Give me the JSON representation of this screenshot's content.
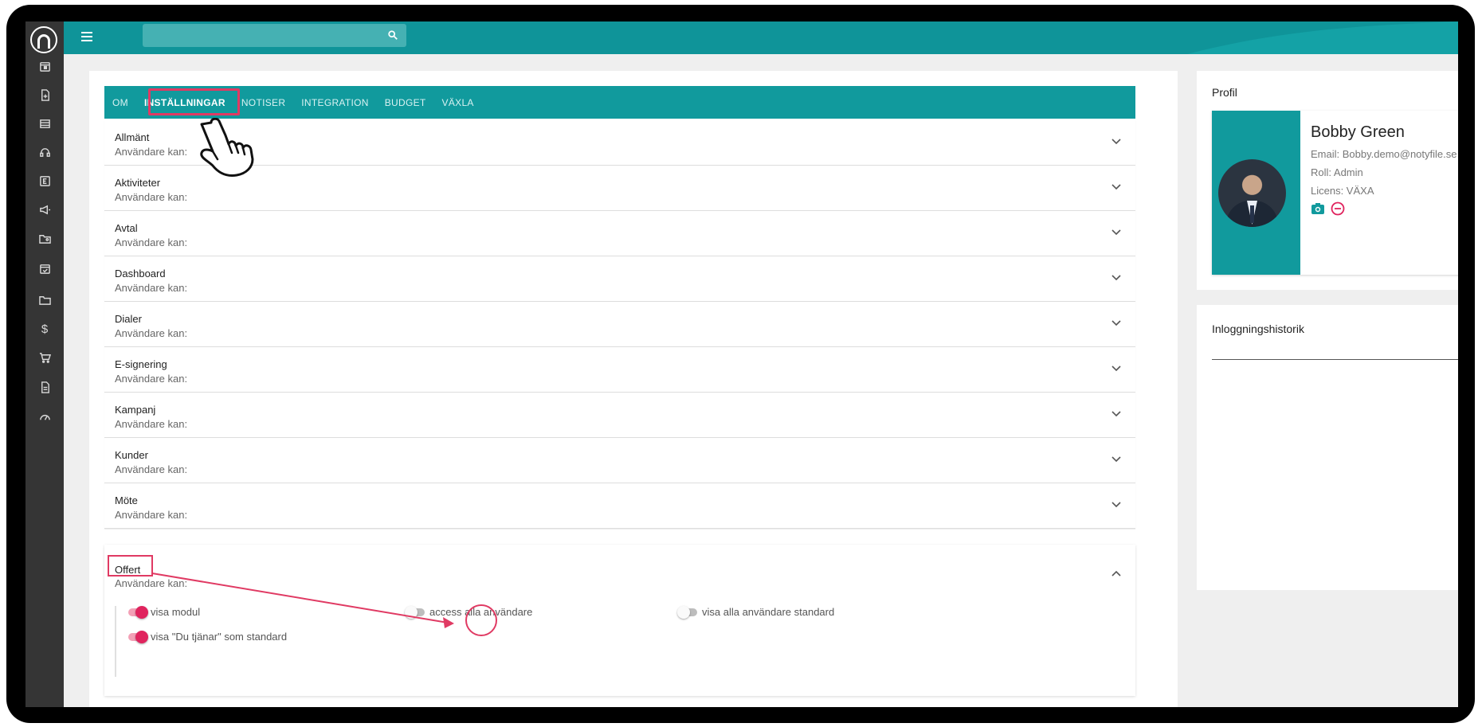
{
  "search": {
    "placeholder": ""
  },
  "tabs": [
    "OM",
    "INSTÄLLNINGAR",
    "NOTISER",
    "INTEGRATION",
    "BUDGET",
    "VÄXLA"
  ],
  "active_tab": "INSTÄLLNINGAR",
  "sections": [
    {
      "title": "Allmänt",
      "subtitle": "Användare kan:"
    },
    {
      "title": "Aktiviteter",
      "subtitle": "Användare kan:"
    },
    {
      "title": "Avtal",
      "subtitle": "Användare kan:"
    },
    {
      "title": "Dashboard",
      "subtitle": "Användare kan:"
    },
    {
      "title": "Dialer",
      "subtitle": "Användare kan:"
    },
    {
      "title": "E-signering",
      "subtitle": "Användare kan:"
    },
    {
      "title": "Kampanj",
      "subtitle": "Användare kan:"
    },
    {
      "title": "Kunder",
      "subtitle": "Användare kan:"
    },
    {
      "title": "Möte",
      "subtitle": "Användare kan:"
    }
  ],
  "offert": {
    "title": "Offert",
    "subtitle": "Användare kan:",
    "options": [
      {
        "label": "visa modul",
        "on": true
      },
      {
        "label": "access alla användare",
        "on": false
      },
      {
        "label": "visa alla användare standard",
        "on": false
      },
      {
        "label": "visa \"Du tjänar\" som standard",
        "on": true
      }
    ]
  },
  "profile": {
    "card_title": "Profil",
    "name": "Bobby Green",
    "email": "Email: Bobby.demo@notyfile.se",
    "role": "Roll: Admin",
    "license": "Licens: VÄXA",
    "icons": [
      "camera-icon",
      "remove-circle-icon"
    ]
  },
  "login_history": {
    "title": "Inloggningshistorik"
  },
  "sidebar_icons": [
    "calendar-icon",
    "document-add-icon",
    "list-icon",
    "headset-icon",
    "e-icon",
    "megaphone-icon",
    "folder-person-icon",
    "calendar-check-icon",
    "folder-icon",
    "dollar-icon",
    "cart-icon",
    "file-icon",
    "dashboard-gauge-icon"
  ],
  "colors": {
    "teal": "#0f9499",
    "accent_pink": "#e0245e",
    "highlight": "#e03a63",
    "sidebar": "#353535"
  }
}
